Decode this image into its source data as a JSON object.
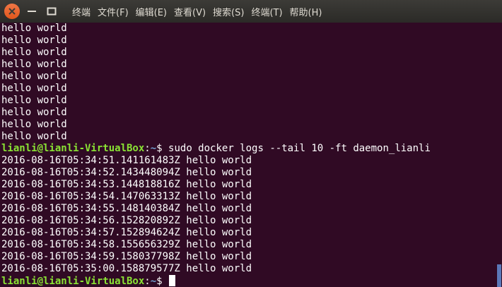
{
  "window": {
    "menu": [
      "终端",
      "文件(F)",
      "编辑(E)",
      "查看(V)",
      "搜索(S)",
      "终端(T)",
      "帮助(H)"
    ]
  },
  "terminal": {
    "output_before": [
      "hello world",
      "hello world",
      "hello world",
      "hello world",
      "hello world",
      "hello world",
      "hello world",
      "hello world",
      "hello world",
      "hello world"
    ],
    "prompt_user": "lianli@lianli-VirtualBox",
    "prompt_sep": ":",
    "prompt_path": "~",
    "prompt_symbol": "$ ",
    "command": "sudo docker logs --tail 10 -ft daemon_lianli",
    "log_lines": [
      "2016-08-16T05:34:51.141161483Z hello world",
      "2016-08-16T05:34:52.143448094Z hello world",
      "2016-08-16T05:34:53.144818816Z hello world",
      "2016-08-16T05:34:54.147063313Z hello world",
      "2016-08-16T05:34:55.148140384Z hello world",
      "2016-08-16T05:34:56.152820892Z hello world",
      "2016-08-16T05:34:57.152894624Z hello world",
      "2016-08-16T05:34:58.155656329Z hello world",
      "2016-08-16T05:34:59.158037798Z hello world",
      "2016-08-16T05:35:00.158879577Z hello world"
    ]
  },
  "colors": {
    "background": "#300a24",
    "prompt_user": "#8ae234",
    "prompt_path": "#729fcf",
    "close_button": "#e95420"
  }
}
